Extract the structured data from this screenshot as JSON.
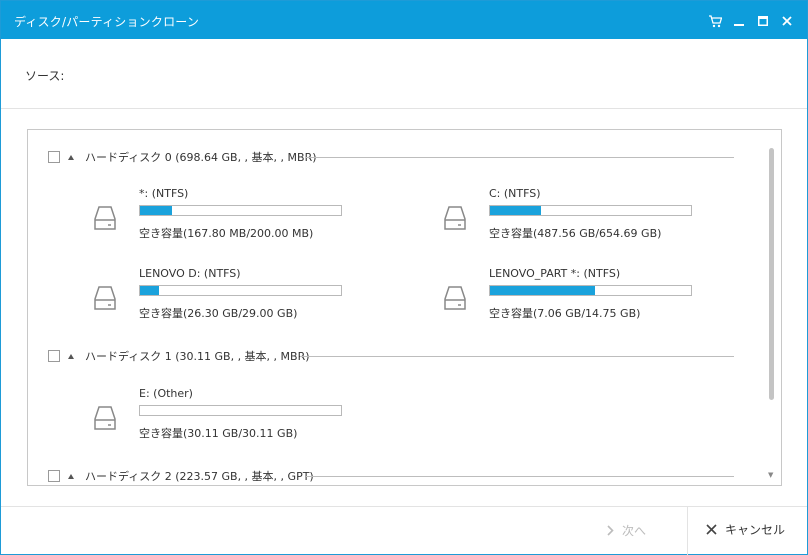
{
  "window": {
    "title": "ディスク/パーティションクローン"
  },
  "source": {
    "label": "ソース:"
  },
  "disks": [
    {
      "title": "ハードディスク 0 (698.64 GB, , 基本, , MBR)",
      "partitions": [
        {
          "name": "*: (NTFS)",
          "free": "空き容量(167.80 MB/200.00 MB)",
          "used_fraction": 0.161
        },
        {
          "name": "C: (NTFS)",
          "free": "空き容量(487.56 GB/654.69 GB)",
          "used_fraction": 0.255
        },
        {
          "name": "LENOVO D: (NTFS)",
          "free": "空き容量(26.30 GB/29.00 GB)",
          "used_fraction": 0.093
        },
        {
          "name": "LENOVO_PART *: (NTFS)",
          "free": "空き容量(7.06 GB/14.75 GB)",
          "used_fraction": 0.521
        }
      ]
    },
    {
      "title": "ハードディスク 1 (30.11 GB, , 基本, , MBR)",
      "partitions": [
        {
          "name": "E: (Other)",
          "free": "空き容量(30.11 GB/30.11 GB)",
          "used_fraction": 0.0
        }
      ]
    },
    {
      "title": "ハードディスク 2 (223.57 GB, , 基本, , GPT)",
      "partitions": []
    }
  ],
  "footer": {
    "next_label": "次へ",
    "cancel_label": "キャンセル"
  },
  "colors": {
    "accent": "#0d9ddb",
    "bar_fill": "#1aa2dc"
  }
}
